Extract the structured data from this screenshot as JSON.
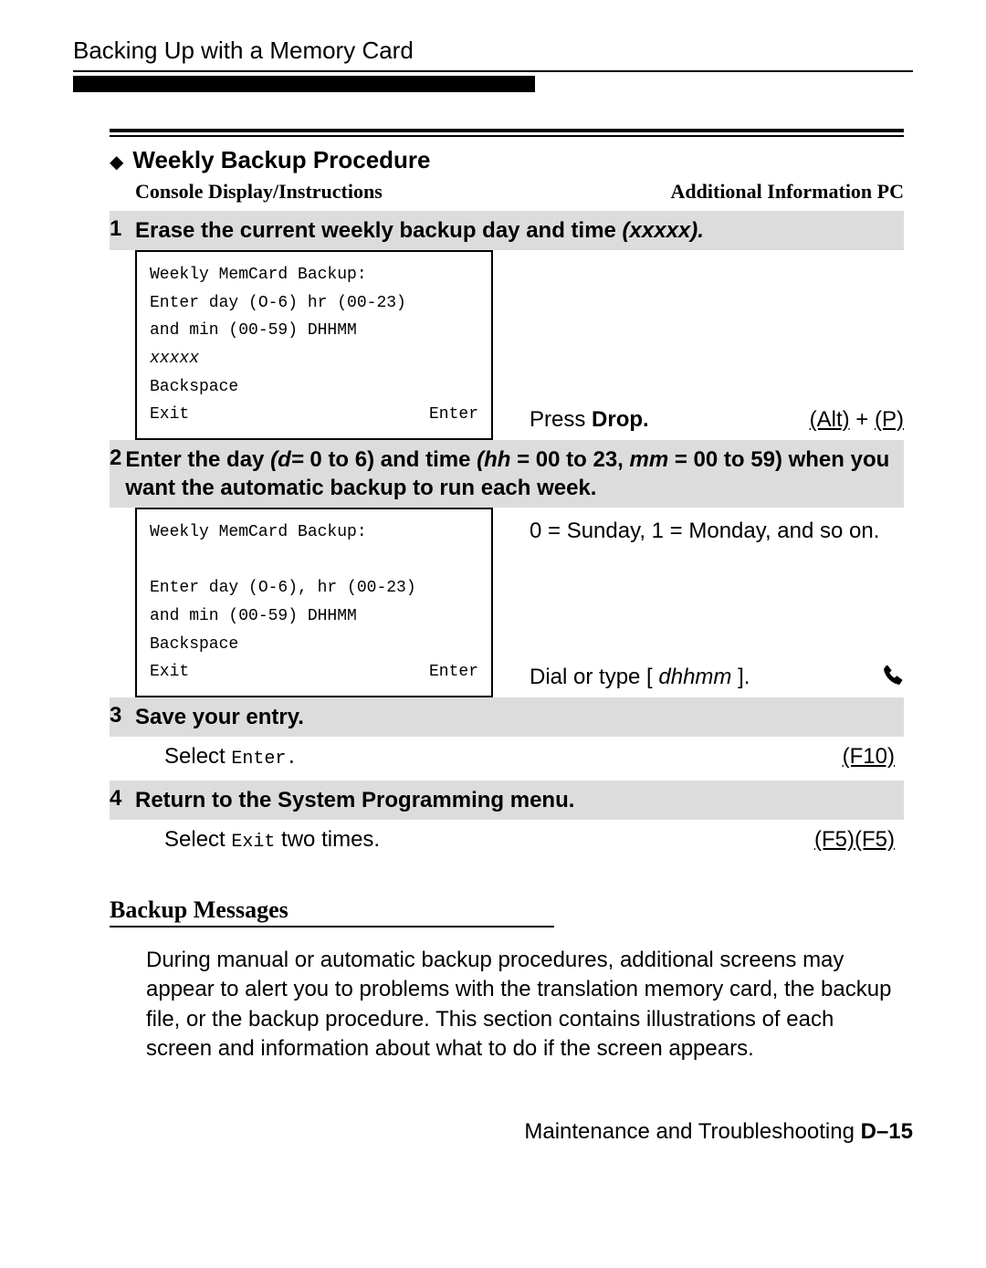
{
  "header": {
    "section_title": "Backing Up with a Memory Card"
  },
  "procedure": {
    "title": "Weekly Backup Procedure",
    "subhead_left": "Console Display/Instructions",
    "subhead_right": "Additional Information PC"
  },
  "step1": {
    "num": "1",
    "text_prefix": "Erase the current weekly backup day and time ",
    "text_ital": "(xxxxx).",
    "console_l1": "Weekly MemCard Backup:",
    "console_l2": "Enter day (O-6) hr (00-23)",
    "console_l3": "and min (00-59) DHHMM",
    "console_l4": "xxxxx",
    "console_b1": "Backspace",
    "console_b2": "Exit",
    "console_b3": "Enter",
    "right_press": "Press ",
    "right_drop": "Drop.",
    "right_key1": "(Alt)",
    "right_plus": " + ",
    "right_key2": "(P)"
  },
  "step2": {
    "num": "2",
    "text_a": "Enter the day ",
    "text_b": "(d= ",
    "text_c": "0 to 6) and time ",
    "text_d": "(hh ",
    "text_e": "= 00 to 23, ",
    "text_f": "mm ",
    "text_g": "= 00 to 59) when you want the automatic backup to run each week.",
    "console_l1": "Weekly MemCard Backup:",
    "console_l2": "Enter day (O-6), hr (00-23)",
    "console_l3": "and min (00-59) DHHMM",
    "console_b1": "Backspace",
    "console_b2": "Exit",
    "console_b3": "Enter",
    "right_top": "0 = Sunday, 1 = Monday, and so on.",
    "right_dial_a": "Dial or type [ ",
    "right_dial_b": "dhhmm",
    "right_dial_c": " ]."
  },
  "step3": {
    "num": "3",
    "text": "Save your entry.",
    "left_a": "Select ",
    "left_b": "Enter.",
    "right": "(F10)"
  },
  "step4": {
    "num": "4",
    "text": "Return to the System Programming menu.",
    "left_a": "Select ",
    "left_b": "Exit",
    "left_c": " two times.",
    "right": "(F5)(F5)"
  },
  "backup_messages": {
    "heading": "Backup Messages",
    "para": "During manual or automatic backup procedures, additional screens may appear to alert you to problems with the translation memory card, the backup file, or the backup procedure. This section contains illustrations of each screen and information about what to do if the screen appears."
  },
  "footer": {
    "text_a": "Maintenance and Troubleshooting ",
    "text_b": "D–15"
  }
}
